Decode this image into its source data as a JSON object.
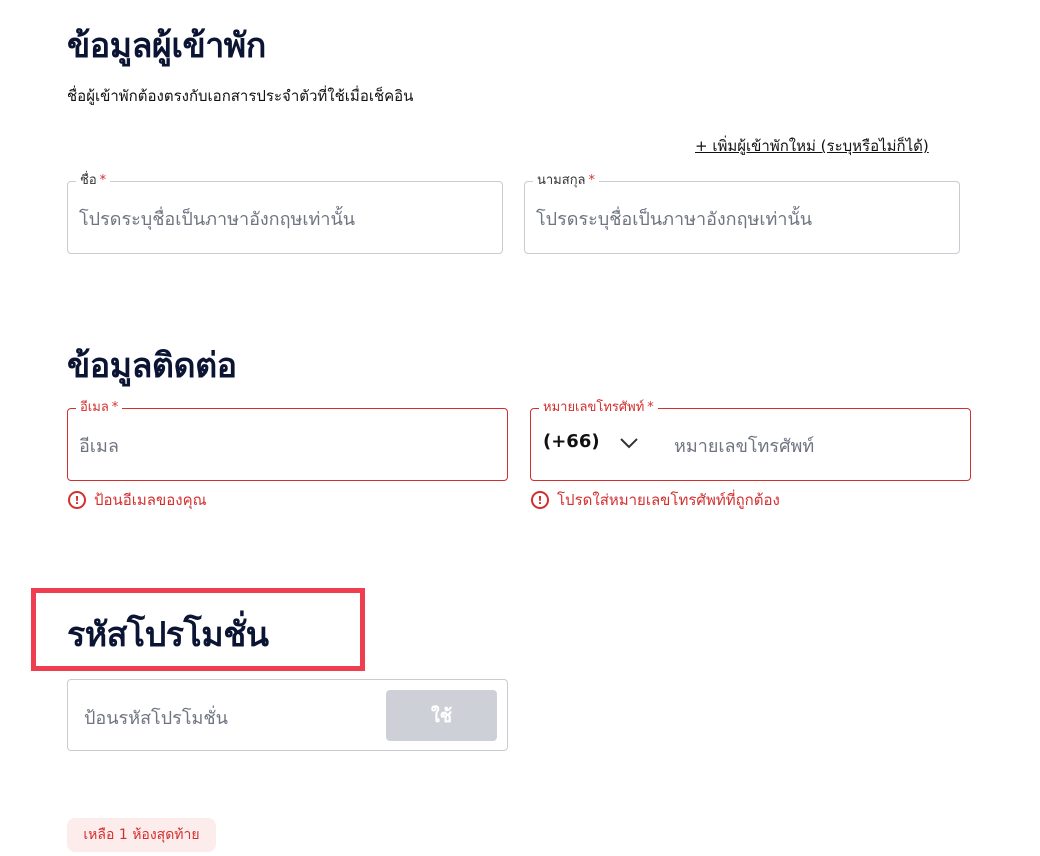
{
  "guest_section": {
    "title": "ข้อมูลผู้เข้าพัก",
    "subtitle": "ชื่อผู้เข้าพักต้องตรงกับเอกสารประจำตัวที่ใช้เมื่อเช็คอิน",
    "add_guest_link": "+ เพิ่มผู้เข้าพักใหม่ (ระบุหรือไม่ก็ได้)",
    "first_name": {
      "label": "ชื่อ",
      "required_mark": "*",
      "placeholder": "โปรดระบุชื่อเป็นภาษาอังกฤษเท่านั้น"
    },
    "last_name": {
      "label": "นามสกุล",
      "required_mark": "*",
      "placeholder": "โปรดระบุชื่อเป็นภาษาอังกฤษเท่านั้น"
    }
  },
  "contact_section": {
    "title": "ข้อมูลติดต่อ",
    "email": {
      "label": "อีเมล",
      "required_mark": "*",
      "placeholder": "อีเมล",
      "error": "ป้อนอีเมลของคุณ"
    },
    "phone": {
      "label": "หมายเลขโทรศัพท์",
      "required_mark": "*",
      "country_code": "(+66)",
      "placeholder": "หมายเลขโทรศัพท์",
      "error": "โปรดใส่หมายเลขโทรศัพท์ที่ถูกต้อง"
    },
    "error_icon_glyph": "!"
  },
  "promo_section": {
    "title": "รหัสโปรโมชั่น",
    "placeholder": "ป้อนรหัสโปรโมชั่น",
    "apply_label": "ใช้"
  },
  "availability_badge": "เหลือ 1 ห้องสุดท้าย",
  "colors": {
    "heading": "#0b1533",
    "error": "#d32f2f",
    "highlight": "#ef3e4f",
    "button_disabled": "#cdd1d7",
    "badge_bg": "#fdecec"
  }
}
